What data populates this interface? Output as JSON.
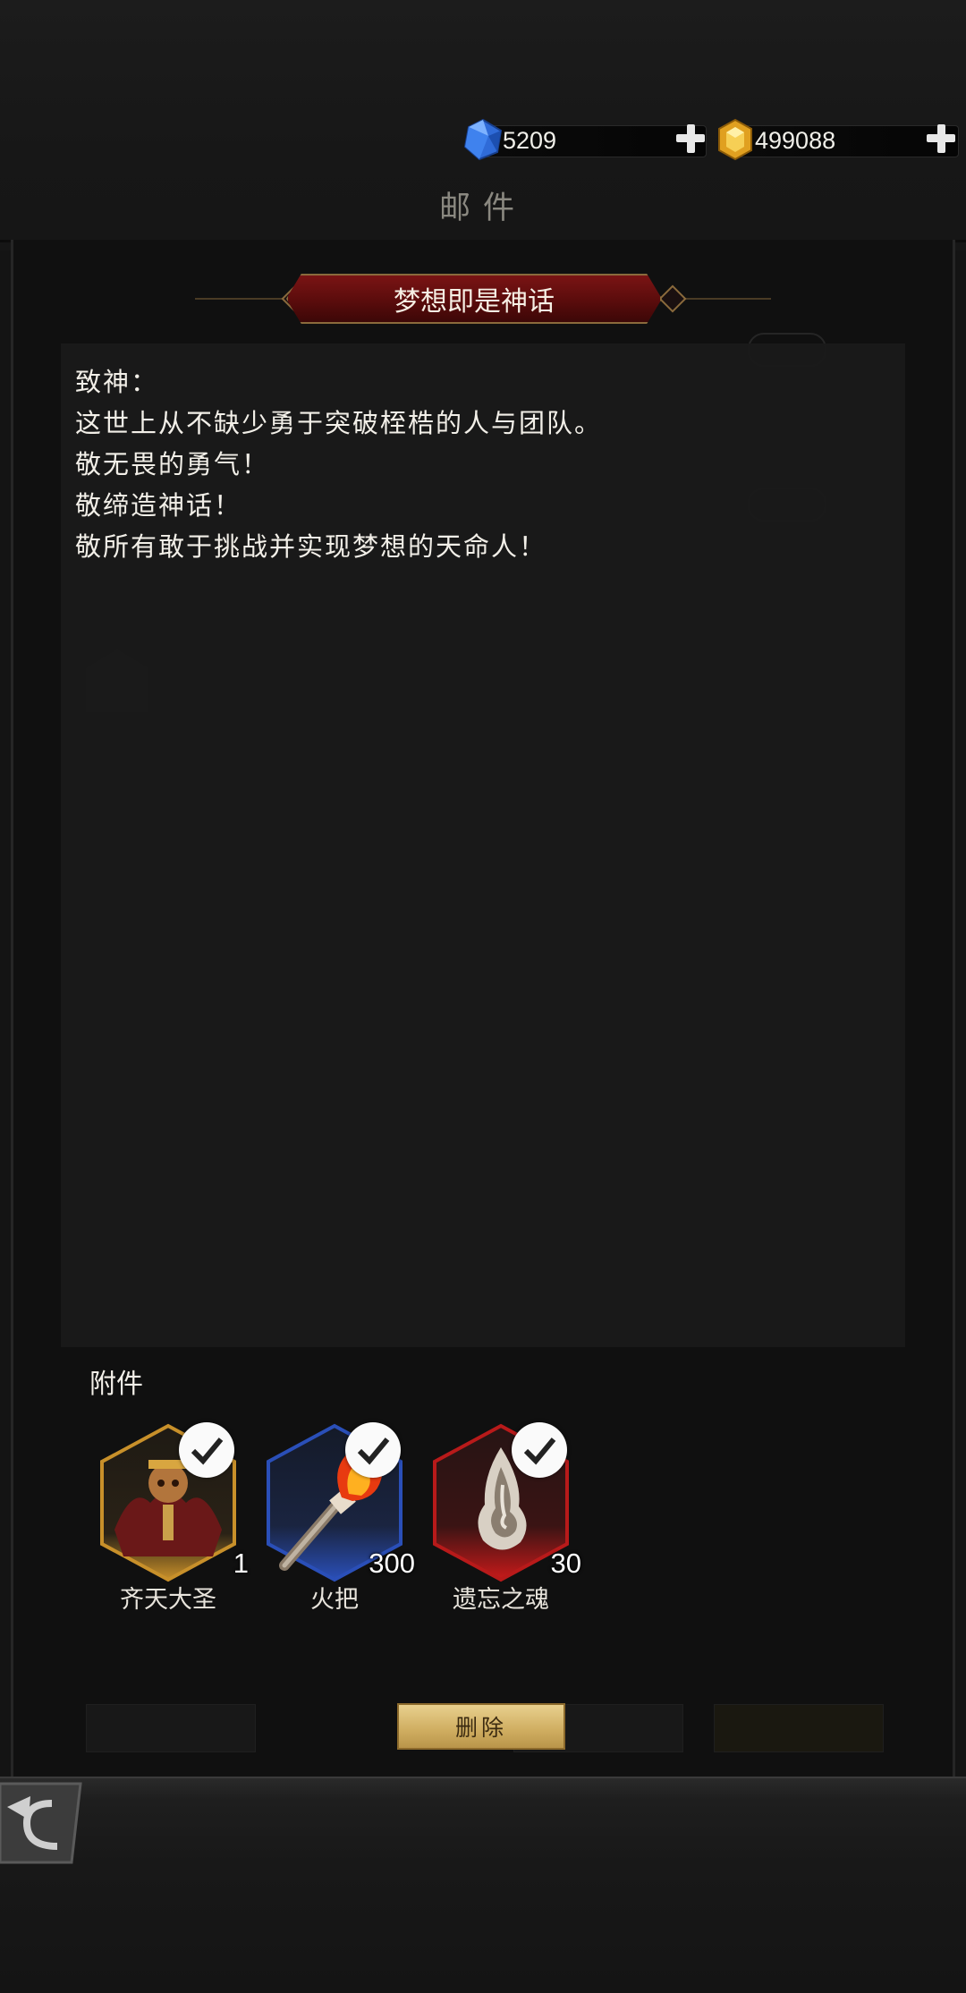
{
  "currency": {
    "gems": "5209",
    "gold": "499088"
  },
  "page_title": "邮件",
  "mail": {
    "subject": "梦想即是神话",
    "body_lines": [
      "致神：",
      "这世上从不缺少勇于突破桎梏的人与团队。",
      "敬无畏的勇气！",
      "敬缔造神话！",
      "敬所有敢于挑战并实现梦想的天命人！"
    ]
  },
  "attachments": {
    "title": "附件",
    "items": [
      {
        "name": "齐天大圣",
        "count": "1",
        "frame_color": "#c8902a",
        "icon": "monkey-king-icon"
      },
      {
        "name": "火把",
        "count": "300",
        "frame_color": "#2a4fb8",
        "icon": "torch-icon"
      },
      {
        "name": "遗忘之魂",
        "count": "30",
        "frame_color": "#b81a1a",
        "icon": "soul-flame-icon"
      }
    ]
  },
  "actions": {
    "delete_label": "删除"
  },
  "colors": {
    "ribbon": "#7a1414",
    "delete_button": "#d8bb72"
  }
}
